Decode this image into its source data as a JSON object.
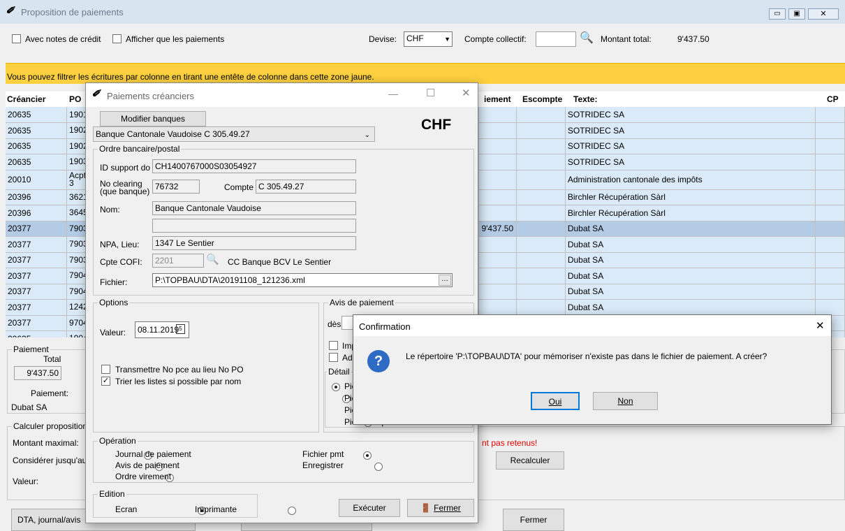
{
  "main": {
    "title": "Proposition de paiements",
    "opt_credit": "Avec notes de crédit",
    "opt_only_payments": "Afficher que les paiements",
    "devise_label": "Devise:",
    "devise_value": "CHF",
    "compte_label": "Compte collectif:",
    "montant_label": "Montant total:",
    "montant_value": "9'437.50",
    "hint": "Vous pouvez filtrer les écritures par colonne en tirant une entête de colonne dans cette zone jaune.",
    "columns": {
      "creancier": "Créancier",
      "po": "PO",
      "paiement": "iement",
      "escompte": "Escompte",
      "texte": "Texte:",
      "cp": "CP"
    },
    "rows": [
      {
        "creancier": "20635",
        "po": "1901",
        "paiement": "",
        "texte": "SOTRIDEC SA"
      },
      {
        "creancier": "20635",
        "po": "1902",
        "paiement": "",
        "texte": "SOTRIDEC SA"
      },
      {
        "creancier": "20635",
        "po": "1902",
        "paiement": "",
        "texte": "SOTRIDEC SA"
      },
      {
        "creancier": "20635",
        "po": "1903",
        "paiement": "",
        "texte": "SOTRIDEC SA"
      },
      {
        "creancier": "20010",
        "po": "Acpt 3",
        "paiement": "",
        "texte": "Administration cantonale des impôts"
      },
      {
        "creancier": "20396",
        "po": "3621",
        "paiement": "",
        "texte": "Birchler Récupération Sàrl"
      },
      {
        "creancier": "20396",
        "po": "3645",
        "paiement": "",
        "texte": "Birchler Récupération Sàrl"
      },
      {
        "creancier": "20377",
        "po": "7903",
        "paiement": "9'437.50",
        "texte": "Dubat SA"
      },
      {
        "creancier": "20377",
        "po": "7903",
        "paiement": "",
        "texte": "Dubat SA"
      },
      {
        "creancier": "20377",
        "po": "7903",
        "paiement": "",
        "texte": "Dubat SA"
      },
      {
        "creancier": "20377",
        "po": "7904",
        "paiement": "",
        "texte": "Dubat SA"
      },
      {
        "creancier": "20377",
        "po": "7904",
        "paiement": "",
        "texte": "Dubat SA"
      },
      {
        "creancier": "20377",
        "po": "1242",
        "paiement": "",
        "texte": "Dubat SA"
      },
      {
        "creancier": "20377",
        "po": "9704",
        "paiement": "",
        "texte": "Dubat SA"
      },
      {
        "creancier": "20635",
        "po": "1904",
        "paiement": "",
        "texte": ""
      }
    ],
    "paiement_group": "Paiement",
    "total_label": "Total",
    "total_value": "9'437.50",
    "paiement_label": "Paiement:",
    "paiement_name": "Dubat SA",
    "calc_group": "Calculer proposition",
    "montant_max": "Montant maximal:",
    "considerer": "Considérer jusqu'au",
    "valeur": "Valeur:",
    "warning": "nt pas retenus!",
    "recalc": "Recalculer",
    "dta_btn": "DTA, journal/avis",
    "fermer": "Fermer"
  },
  "dlg1": {
    "title": "Paiements créanciers",
    "modify_banks": "Modifier banques",
    "bank": "Banque Cantonale Vaudoise C 305.49.27",
    "currency": "CHF",
    "ordre_group": "Ordre bancaire/postal",
    "id_label": "ID support do",
    "id_value": "CH1400767000S03054927",
    "clearing_label": "No clearing (que banque)",
    "clearing_value": "76732",
    "compte_label": "Compte",
    "compte_value": "C 305.49.27",
    "nom_label": "Nom:",
    "nom_value": "Banque Cantonale Vaudoise",
    "npa_label": "NPA, Lieu:",
    "npa_value": "1347 Le Sentier",
    "cofi_label": "Cpte COFI:",
    "cofi_value": "2201",
    "cofi_desc": "CC Banque BCV Le Sentier",
    "fichier_label": "Fichier:",
    "fichier_value": "P:\\TOPBAU\\DTA\\20191108_121236.xml",
    "options_group": "Options",
    "valeur_label": "Valeur:",
    "valeur_value": "08.11.2019",
    "transmettre": "Transmettre No pce au lieu No PO",
    "trier": "Trier les listes si possible par nom",
    "avis_group": "Avis de paiement",
    "des": "dès",
    "imp": "Imp",
    "adr": "Adr",
    "detail": "Détail",
    "pie1": "Piè",
    "pie2": "Piè",
    "pie3": "Piè",
    "pie4": "Pièce unique sans détail",
    "operation_group": "Opération",
    "op_journal": "Journal de paiement",
    "op_avis": "Avis de paiement",
    "op_ordre": "Ordre virement",
    "op_fichier": "Fichier pmt",
    "op_enreg": "Enregistrer",
    "edition_group": "Edition",
    "ed_ecran": "Ecran",
    "ed_imprimante": "Imprimante",
    "executer": "Exécuter",
    "fermer": "Fermer"
  },
  "dlg2": {
    "title": "Confirmation",
    "message": "Le répertoire 'P:\\TOPBAU\\DTA' pour mémoriser n'existe pas dans le fichier de paiement. A créer?",
    "oui": "Oui",
    "non": "Non"
  },
  "colors": {
    "hint_bg": "#fcd03f",
    "row_bg": "#daeaf8",
    "row_sel": "#b4cbe6",
    "accent": "#2d6bc4"
  }
}
